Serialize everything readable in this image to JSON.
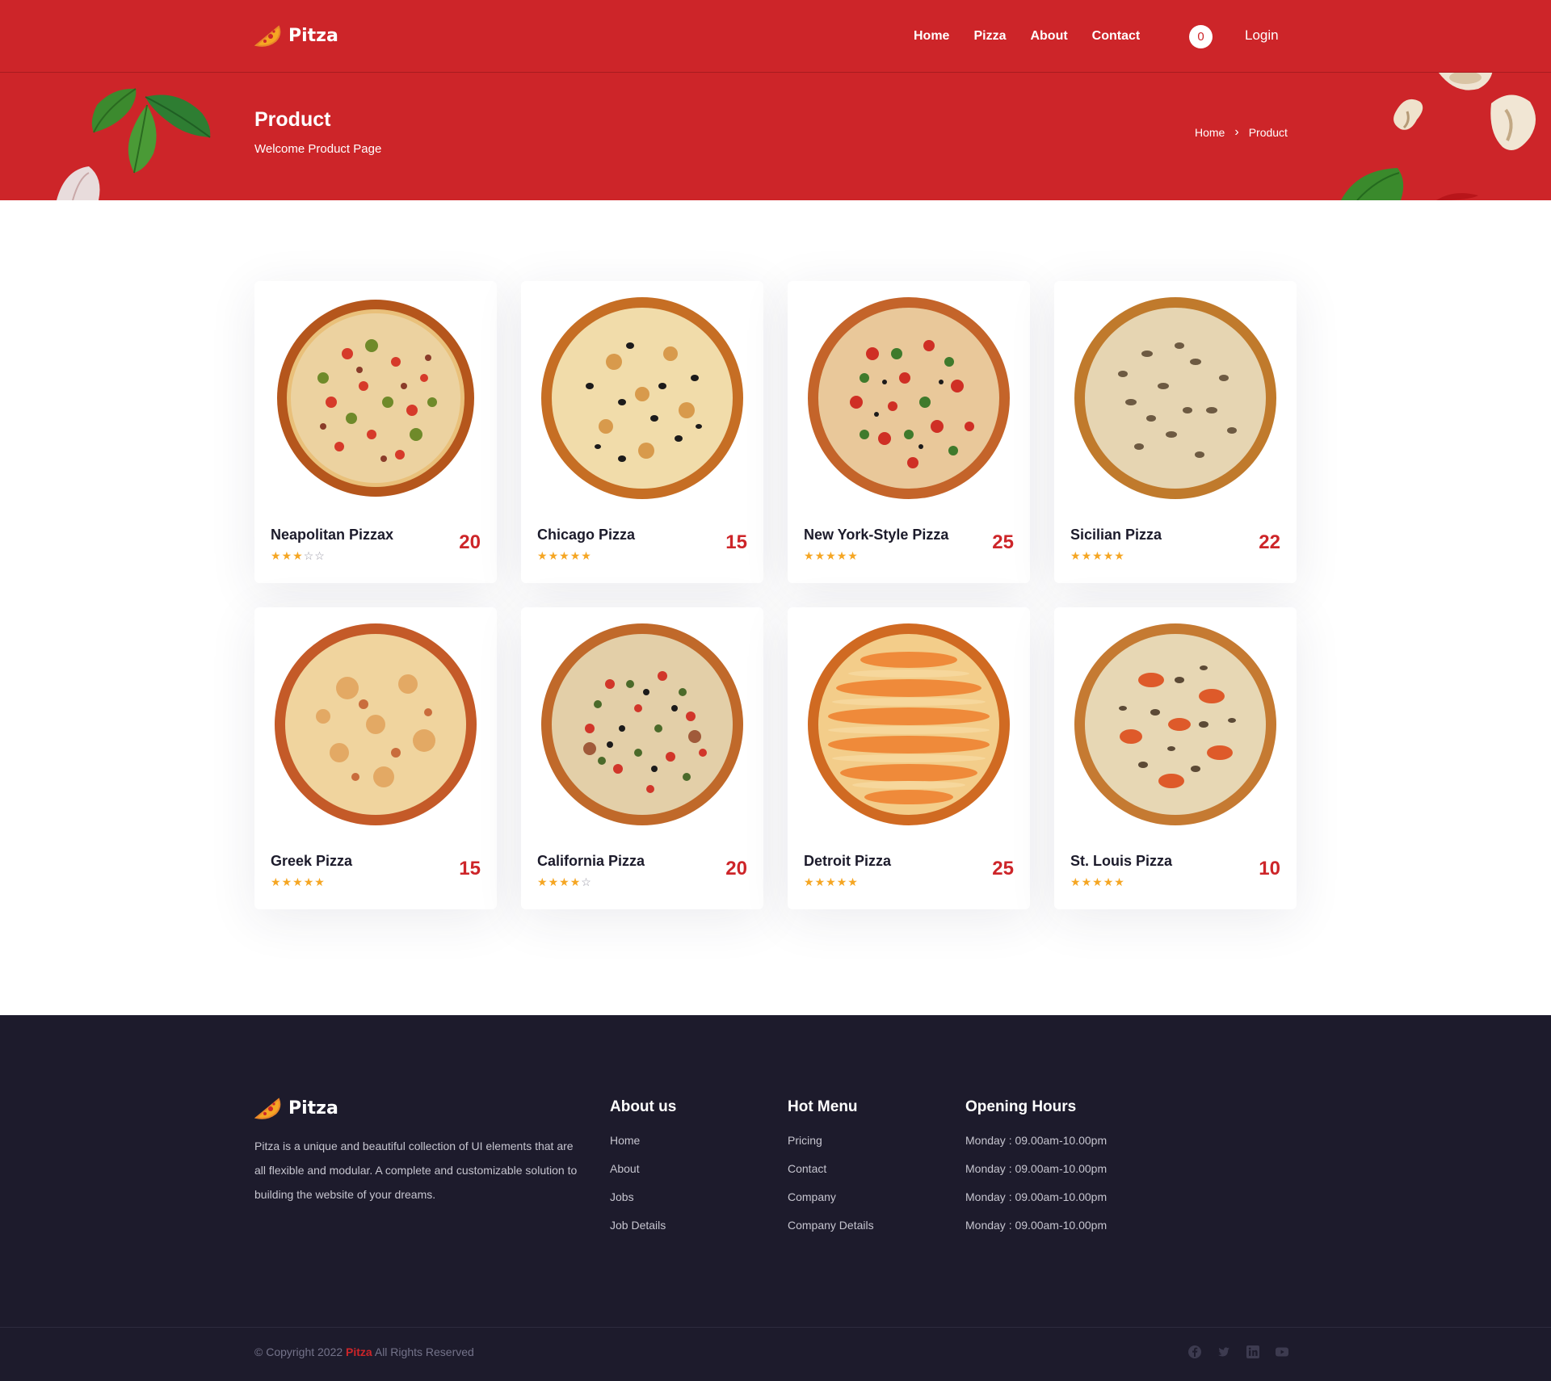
{
  "brand": {
    "name": "Pitza",
    "accent": "#cd2529",
    "star_color": "#f5a623",
    "footer_bg": "#1d1b2c"
  },
  "nav": {
    "items": [
      {
        "label": "Home"
      },
      {
        "label": "Pizza"
      },
      {
        "label": "About"
      },
      {
        "label": "Contact"
      }
    ],
    "cart_count": "0",
    "login": "Login"
  },
  "banner": {
    "title": "Product",
    "subtitle": "Welcome Product Page",
    "breadcrumb": [
      "Home",
      "Product"
    ]
  },
  "products": [
    {
      "name": "Neapolitan Pizzax",
      "price": "20",
      "rating": 3,
      "image": "pizza-neapolitan"
    },
    {
      "name": "Chicago Pizza",
      "price": "15",
      "rating": 5,
      "image": "pizza-chicago"
    },
    {
      "name": "New York-Style Pizza",
      "price": "25",
      "rating": 5,
      "image": "pizza-newyork"
    },
    {
      "name": "Sicilian Pizza",
      "price": "22",
      "rating": 5,
      "image": "pizza-sicilian"
    },
    {
      "name": "Greek Pizza",
      "price": "15",
      "rating": 5,
      "image": "pizza-greek"
    },
    {
      "name": "California Pizza",
      "price": "20",
      "rating": 4,
      "image": "pizza-california"
    },
    {
      "name": "Detroit Pizza",
      "price": "25",
      "rating": 5,
      "image": "pizza-detroit"
    },
    {
      "name": "St. Louis Pizza",
      "price": "10",
      "rating": 5,
      "image": "pizza-stlouis"
    }
  ],
  "footer": {
    "description": "Pitza is a unique and beautiful collection of UI elements that are all flexible and modular. A complete and customizable solution to building the website of your dreams.",
    "columns": [
      {
        "title": "About us",
        "links": [
          "Home",
          "About",
          "Jobs",
          "Job Details"
        ]
      },
      {
        "title": "Hot Menu",
        "links": [
          "Pricing",
          "Contact",
          "Company",
          "Company Details"
        ]
      },
      {
        "title": "Opening Hours",
        "links": [
          "Monday : 09.00am-10.00pm",
          "Monday : 09.00am-10.00pm",
          "Monday : 09.00am-10.00pm",
          "Monday : 09.00am-10.00pm"
        ]
      }
    ],
    "copyright_prefix": "© Copyright 2022",
    "copyright_brand": "Pitza",
    "copyright_suffix": "All Rights Reserved",
    "social": [
      "facebook-icon",
      "twitter-icon",
      "linkedin-icon",
      "youtube-icon"
    ]
  }
}
